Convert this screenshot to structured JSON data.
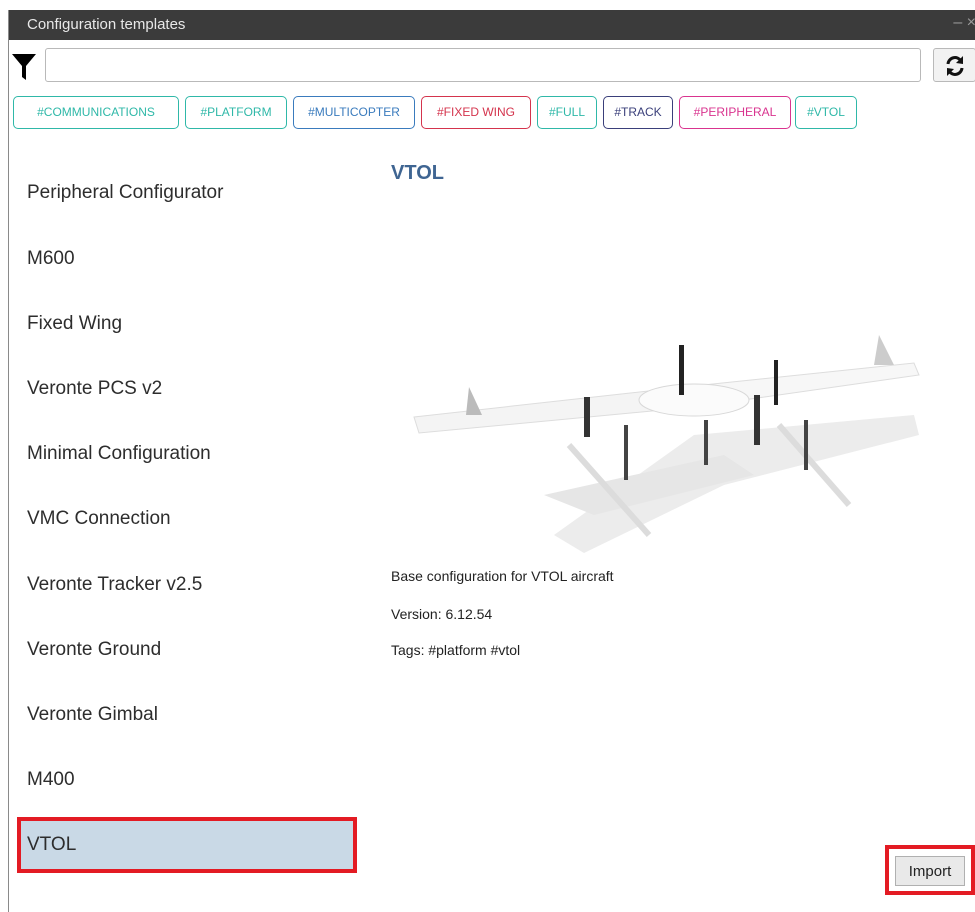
{
  "window": {
    "title": "Configuration templates",
    "controls": "– ×"
  },
  "search": {
    "value": "",
    "placeholder": ""
  },
  "tags": [
    {
      "label": "#COMMUNICATIONS",
      "color": "#2fb8a8"
    },
    {
      "label": "#PLATFORM",
      "color": "#2fb8a8"
    },
    {
      "label": "#MULTICOPTER",
      "color": "#3a7bbd"
    },
    {
      "label": "#FIXED WING",
      "color": "#d4344d"
    },
    {
      "label": "#FULL",
      "color": "#2fb8a8"
    },
    {
      "label": "#TRACK",
      "color": "#3a3f7a"
    },
    {
      "label": "#PERIPHERAL",
      "color": "#d9348f"
    },
    {
      "label": "#VTOL",
      "color": "#2fb8a8"
    }
  ],
  "templates": [
    "Peripheral Configurator",
    "M600",
    "Fixed Wing",
    "Veronte PCS v2",
    "Minimal Configuration",
    "VMC Connection",
    "Veronte Tracker v2.5",
    "Veronte Ground",
    "Veronte Gimbal",
    "M400",
    "VTOL"
  ],
  "selected_template": "VTOL",
  "detail": {
    "title": "VTOL",
    "description": "Base configuration for VTOL aircraft",
    "version": "Version: 6.12.54",
    "tags": "Tags: #platform #vtol"
  },
  "actions": {
    "import_label": "Import"
  },
  "colors": {
    "accent_title": "#3f6592",
    "selection_bg": "#c9d9e6",
    "highlight_red": "#e31b23"
  }
}
